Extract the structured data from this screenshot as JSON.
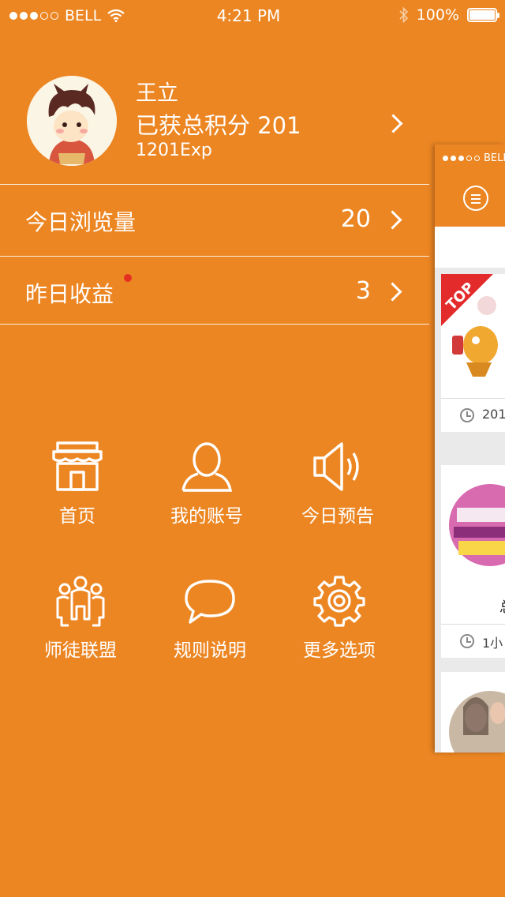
{
  "status_bar": {
    "carrier": "BELL",
    "time": "4:21 PM",
    "battery": "100%"
  },
  "profile": {
    "name": "王立",
    "score_text": "已获总积分 201",
    "exp": "1201Exp"
  },
  "rows": [
    {
      "label": "今日浏览量",
      "value": "20"
    },
    {
      "label": "昨日收益",
      "value": "3",
      "has_badge": true
    }
  ],
  "menu": [
    {
      "label": "首页",
      "icon": "store-icon"
    },
    {
      "label": "我的账号",
      "icon": "user-icon"
    },
    {
      "label": "今日预告",
      "icon": "speaker-icon"
    },
    {
      "label": "师徒联盟",
      "icon": "group-icon"
    },
    {
      "label": "规则说明",
      "icon": "speech-bubble-icon"
    },
    {
      "label": "更多选项",
      "icon": "gear-icon"
    }
  ],
  "preview": {
    "carrier": "BELL",
    "top_badge": "TOP",
    "card1_time": "201",
    "card2_time": "1小",
    "card2_title_fragment": "总"
  },
  "colors": {
    "background": "#EC8623",
    "badge": "#E53020"
  }
}
